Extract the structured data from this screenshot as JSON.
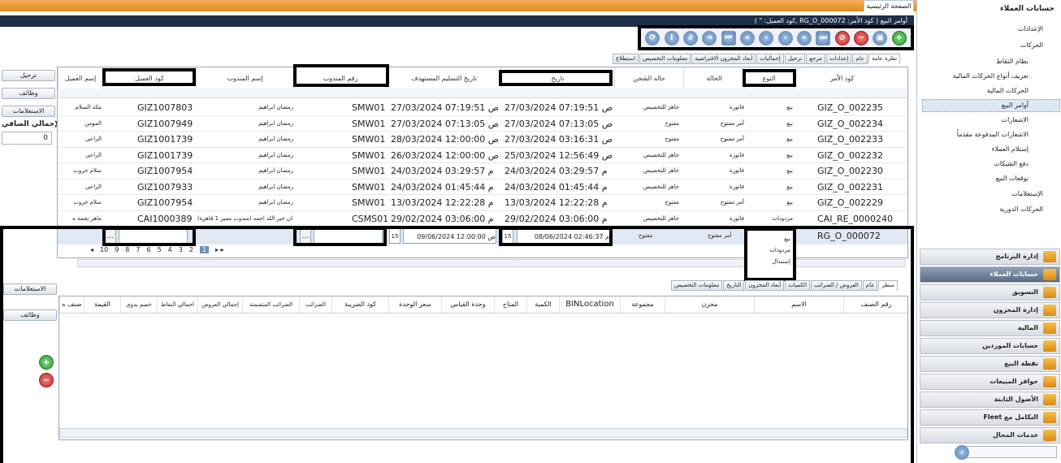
{
  "home_tab": "الصفحة الرئيسية",
  "title_bar": "أوامر البيع    ( كود الأمر: RG_O_000072 ,كود العميل: \" )",
  "left_buttons": {
    "post": "ترحيل",
    "functions": "وظائف",
    "queries": "الاستعلامات",
    "net_total": "الإجمالي الصافي",
    "net_value": "0",
    "bottom_queries": "الاستعلامات",
    "bottom_functions": "وظائف"
  },
  "top_tabs": [
    "نظرة عامة",
    "عام",
    "إعدادات",
    "مرجع",
    "ترحيل",
    "إجماليات",
    "أبعاد المخزون الافتراضية",
    "معلومات التخصيص",
    "استطلاع"
  ],
  "columns": {
    "order_code": "كود الأمر",
    "type": "النوع",
    "status": "الحالة",
    "ship_status": "حاله الشحن",
    "date": "تاريخ",
    "expected_date": "تاريخ التسليم المستهدف",
    "rep_no": "رقم المندوب",
    "rep_name": "إسم المندوب",
    "customer_code": "كود العميل",
    "customer_name": "إسم العميل"
  },
  "rows": [
    {
      "code": "GIZ_O_002235",
      "type": "بيع",
      "status": "فاتورة",
      "ship": "جاهز للتخصيص",
      "date": "27/03/2024 07:19:51 ص",
      "expected": "27/03/2024 07:19:51 ص",
      "rep": "SMW01",
      "rep_name": "رمضان ابراهيم",
      "cust": "GIZ1007803",
      "cust_name": "مكة السلام"
    },
    {
      "code": "GIZ_O_002234",
      "type": "بيع",
      "status": "أمر مفتوح",
      "ship": "مفتوح",
      "date": "27/03/2024 07:13:05 ص",
      "expected": "27/03/2024 07:13:05 ص",
      "rep": "SMW01",
      "rep_name": "رمضان ابراهيم",
      "cust": "GIZ1007949",
      "cust_name": "المومن"
    },
    {
      "code": "GIZ_O_002233",
      "type": "بيع",
      "status": "أمر مفتوح",
      "ship": "مفتوح",
      "date": "27/03/2024 03:16:31 ص",
      "expected": "28/03/2024 12:00:00 ص",
      "rep": "SMW01",
      "rep_name": "رمضان ابراهيم",
      "cust": "GIZ1001739",
      "cust_name": "الراعي"
    },
    {
      "code": "GIZ_O_002232",
      "type": "بيع",
      "status": "فاتورة",
      "ship": "جاهز للتخصيص",
      "date": "25/03/2024 12:56:49 ص",
      "expected": "26/03/2024 12:00:00 ص",
      "rep": "SMW01",
      "rep_name": "رمضان ابراهيم",
      "cust": "GIZ1001739",
      "cust_name": "الراعي"
    },
    {
      "code": "GIZ_O_002230",
      "type": "بيع",
      "status": "فاتورة",
      "ship": "جاهز للتخصيص",
      "date": "24/03/2024 03:29:57 م",
      "expected": "24/03/2024 03:29:57 م",
      "rep": "SMW01",
      "rep_name": "رمضان ابراهيم",
      "cust": "GIZ1007954",
      "cust_name": "سلام حروب"
    },
    {
      "code": "GIZ_O_002231",
      "type": "بيع",
      "status": "فاتورة",
      "ship": "جاهز للتخصيص",
      "date": "24/03/2024 01:45:44 م",
      "expected": "24/03/2024 01:45:44 م",
      "rep": "SMW01",
      "rep_name": "رمضان ابراهيم",
      "cust": "GIZ1007933",
      "cust_name": "الراعي"
    },
    {
      "code": "GIZ_O_002229",
      "type": "بيع",
      "status": "أمر مفتوح",
      "ship": "مفتوح",
      "date": "13/03/2024 12:22:28 م",
      "expected": "13/03/2024 12:22:28 م",
      "rep": "SMW01",
      "rep_name": "رمضان ابراهيم",
      "cust": "GIZ1007954",
      "cust_name": "سلام حروب"
    },
    {
      "code": "CAI_RE_0000240",
      "type": "مردودات",
      "status": "فاتورة",
      "ship": "جاهز للتخصيص",
      "date": "29/02/2024 03:06:00 م",
      "expected": "29/02/2024 03:06:00 م",
      "rep": "CSMS01",
      "rep_name": "سلهدان خير الله احمد (مندوب مميز 1 قاهرة)",
      "cust": "CAI1000389",
      "cust_name": "ماهر نجمة ه"
    }
  ],
  "edit_row": {
    "code": "RG_O_000072",
    "type": "بيع",
    "status": "أمر مفتوح",
    "ship": "مفتوح",
    "date": "08/06/2024 02:46:37 م",
    "expected": "09/06/2024 12:00:00 ص"
  },
  "dropdown": [
    "بيع",
    "مردودات",
    "إستبدال"
  ],
  "pager": [
    "10",
    "9",
    "8",
    "7",
    "6",
    "5",
    "4",
    "3",
    "2",
    "1"
  ],
  "bottom_tabs": [
    "سطر",
    "عام",
    "العروض / الضرائب",
    "الكميات",
    "أبعاد المخزون",
    "التاريخ",
    "معلومات التخصيص"
  ],
  "detail_columns": [
    "رقم الصنف",
    "الاسم",
    "مخزن",
    "مجموعة",
    "BINLocation",
    "الكمية",
    "المتاح",
    "وحدة القياس",
    "سعر الوحدة",
    "كود الضريبة",
    "الضرائب",
    "الضرائب المتضمنة",
    "إجمالي العروض",
    "اجمالي النقاط",
    "خصم يدوي",
    "القيمة",
    "صنف ه"
  ],
  "sidebar": {
    "header": "حسابات العملاء",
    "tree": [
      "الإعدادات",
      "الحركات",
      "نظام النقاط",
      "تعريف أنواع الحركات المالية",
      "الحركات المالية",
      "أوامر البيع",
      "الاشعارات",
      "الاشعارات المدفوعة مقدماً",
      "إستلام العملاء",
      "دفع الشيكات",
      "توقعات البيع",
      "الإستعلامات",
      "الحركات الدورية"
    ],
    "modules": [
      "إدارة البرنامج",
      "حسابات العملاء",
      "التسويق",
      "إدارة المخزون",
      "المالية",
      "حسابات الموردين",
      "نقطة البيع",
      "حوافز المبيعات",
      "الأصول الثابتة",
      "التكامل مع Fleet",
      "خدمات المجال"
    ]
  },
  "colors": {
    "accent": "#1d2f49",
    "orange": "#e08a20"
  }
}
